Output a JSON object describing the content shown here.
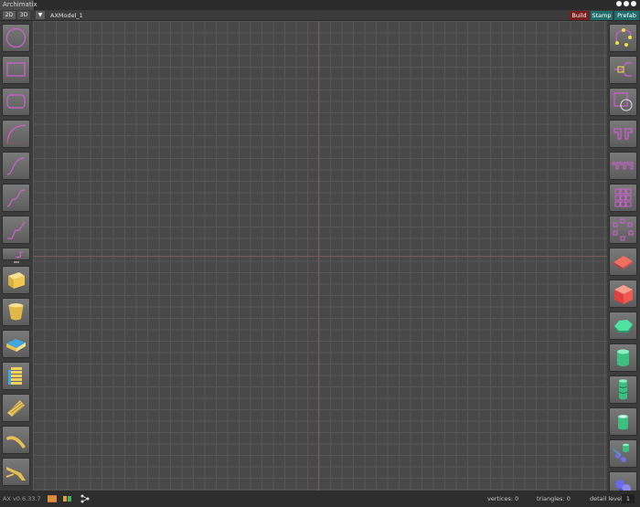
{
  "window": {
    "tab_title": "Archimatix"
  },
  "toolbar": {
    "mode_2d": "2D",
    "mode_3d": "3D",
    "dropdown_glyph": "▼",
    "model_name": "AXModel_1",
    "build_label": "Build",
    "stamp_label": "Stamp",
    "prefab_label": "Prefab"
  },
  "left_palette": [
    {
      "name": "circle-shape-icon"
    },
    {
      "name": "rectangle-shape-icon"
    },
    {
      "name": "rounded-rectangle-shape-icon"
    },
    {
      "name": "curve-shape-icon"
    },
    {
      "name": "s-curve-shape-icon"
    },
    {
      "name": "stairs-curve-shape-icon"
    },
    {
      "name": "step-line-shape-icon"
    },
    {
      "name": "partial-shape-icon"
    },
    {
      "name": "extrude-mesh-icon"
    },
    {
      "name": "lathe-mesh-icon"
    },
    {
      "name": "plan-sweep-mesh-icon"
    },
    {
      "name": "floors-mesh-icon"
    },
    {
      "name": "stair-mesh-icon"
    },
    {
      "name": "sweep-mesh-icon"
    },
    {
      "name": "ramp-mesh-icon"
    }
  ],
  "right_palette": [
    {
      "name": "path-points-icon"
    },
    {
      "name": "shape-merger-icon"
    },
    {
      "name": "shape-difference-icon"
    },
    {
      "name": "shape-mirror-icon"
    },
    {
      "name": "linear-repeater-2d-icon"
    },
    {
      "name": "grid-repeater-2d-icon"
    },
    {
      "name": "radial-repeater-2d-icon"
    },
    {
      "name": "plane-mesh-icon"
    },
    {
      "name": "box-mesh-icon"
    },
    {
      "name": "polygon-mesh-icon"
    },
    {
      "name": "cylinder-mesh-icon"
    },
    {
      "name": "grid-repeater-icon"
    },
    {
      "name": "floor-repeater-icon"
    },
    {
      "name": "instance-scatter-icon"
    },
    {
      "name": "replicant-icon"
    }
  ],
  "status": {
    "version": "AX v0.6.33.7",
    "vertices_label": "vertices: 0",
    "triangles_label": "triangles: 0",
    "detail_label": "detail level",
    "detail_value": "1"
  },
  "colors": {
    "accent_magenta": "#e040e0",
    "build_red": "#7a1d1d",
    "stamp_teal": "#1f6d6d",
    "mesh_yellow": "#f0d060",
    "mesh_green": "#44d088"
  }
}
